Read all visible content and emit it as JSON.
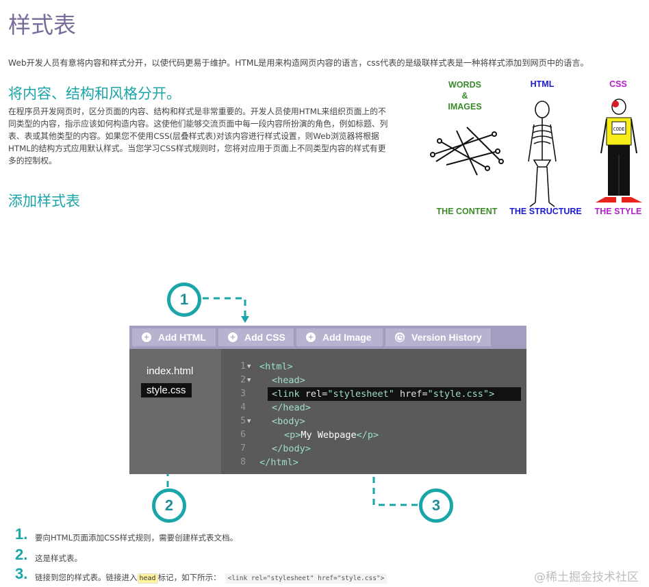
{
  "page": {
    "title": "样式表",
    "intro": "Web开发人员有意将内容和样式分开，以使代码更易于维护。HTML是用来构造网页内容的语言，css代表的是级联样式表是一种将样式添加到网页中的语言。",
    "section1_heading": "将内容、结构和风格分开。",
    "section1_paragraph": "在程序员开发网页时，区分页面的内容、结构和样式是非常重要的。开发人员使用HTML来组织页面上的不同类型的内容，指示应该如何构造内容。这使他们能够交流页面中每一段内容所扮演的角色，例如标题、列表、表或其他类型的内容。如果您不使用CSS(层叠样式表)对该内容进行样式设置，则Web浏览器将根据HTML的结构方式应用默认样式。当您学习CSS样式规则时，您将对应用于页面上不同类型内容的样式有更多的控制权。",
    "section2_heading": "添加样式表"
  },
  "illustration": {
    "label_words": "WORDS",
    "label_amp": "&",
    "label_images": "IMAGES",
    "label_html": "HTML",
    "label_css": "CSS",
    "caption_content": "THE CONTENT",
    "caption_structure": "THE STRUCTURE",
    "caption_style": "THE STYLE",
    "shirt_text": "CODE"
  },
  "editor": {
    "toolbar": [
      "Add HTML",
      "Add CSS",
      "Add Image",
      "Version History"
    ],
    "files": [
      "index.html",
      "style.css"
    ],
    "line_numbers": [
      "1",
      "2",
      "3",
      "4",
      "5",
      "6",
      "7",
      "8"
    ],
    "code": {
      "l1": "<html>",
      "l2": "<head>",
      "l3_open": "<link ",
      "l3_rel_attr": "rel",
      "l3_rel_val": "\"stylesheet\"",
      "l3_href_attr": "href",
      "l3_href_val": "\"style.css\"",
      "l3_close": ">",
      "l4": "</head>",
      "l5": "<body>",
      "l6_open": "<p>",
      "l6_text": "My Webpage",
      "l6_close": "</p>",
      "l7": "</body>",
      "l8": "</html>"
    }
  },
  "callouts": [
    "1",
    "2",
    "3"
  ],
  "steps": [
    {
      "num": "1.",
      "text": "要向HTML页面添加CSS样式规则，需要创建样式表文档。"
    },
    {
      "num": "2.",
      "text": "这是样式表。"
    },
    {
      "num": "3.",
      "text_before": "链接到您的样式表。链接进入",
      "kbd": "head",
      "text_after": "标记，如下所示：",
      "code": "<link rel=\"stylesheet\" href=\"style.css\">"
    }
  ],
  "watermark": "@稀土掘金技术社区",
  "colors": {
    "accent": "#1aa5a8",
    "title": "#7a6c9a",
    "toolbar": "#a59cc1"
  }
}
